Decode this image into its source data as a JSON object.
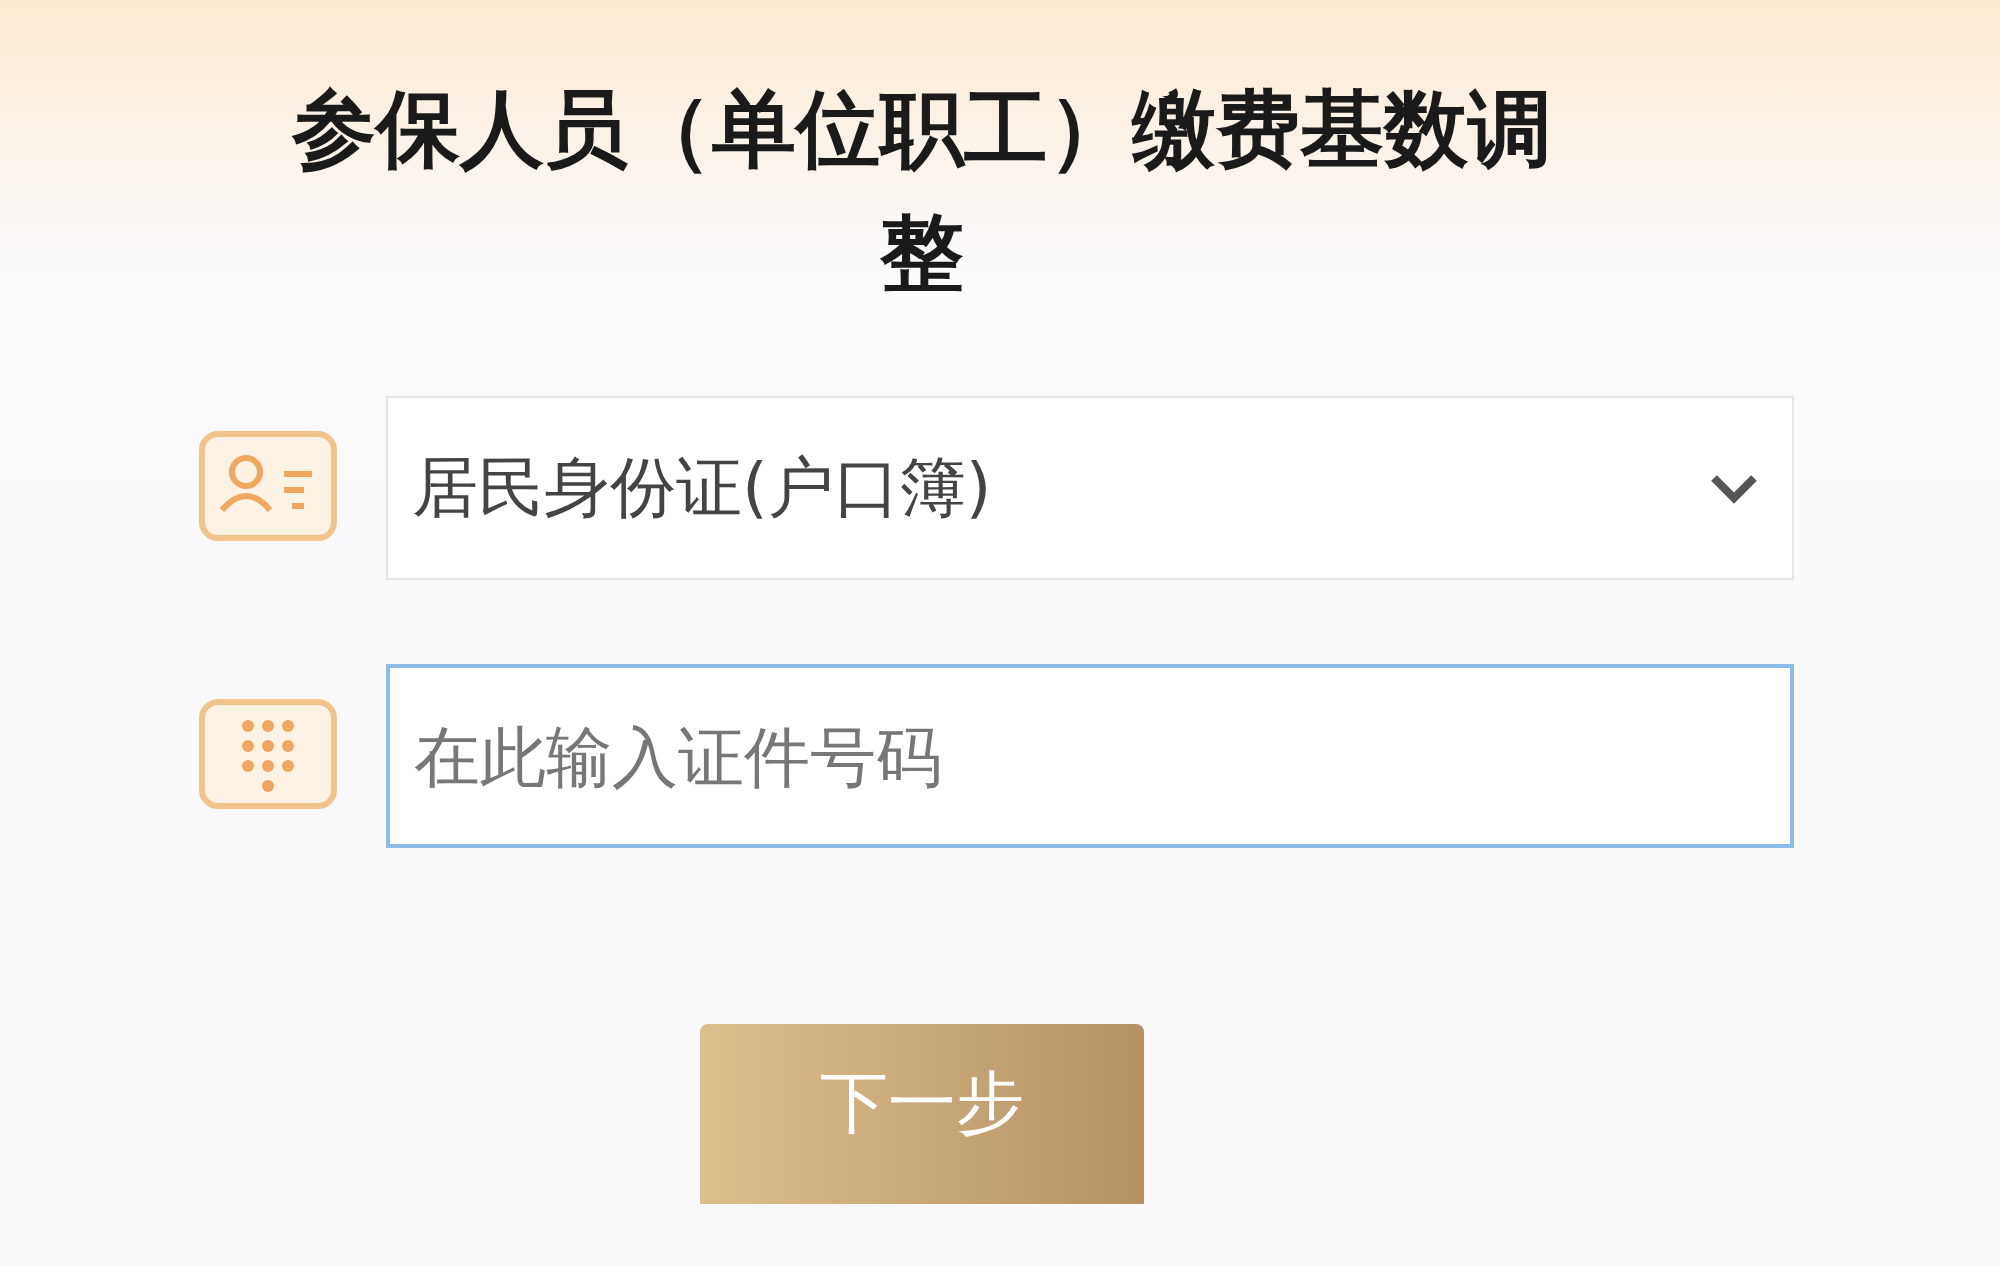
{
  "title": "参保人员（单位职工）缴费基数调整",
  "id_type": {
    "value": "居民身份证(户口簿)"
  },
  "id_number": {
    "placeholder": "在此输入证件号码",
    "focused": true
  },
  "next_button": {
    "label": "下一步"
  }
}
